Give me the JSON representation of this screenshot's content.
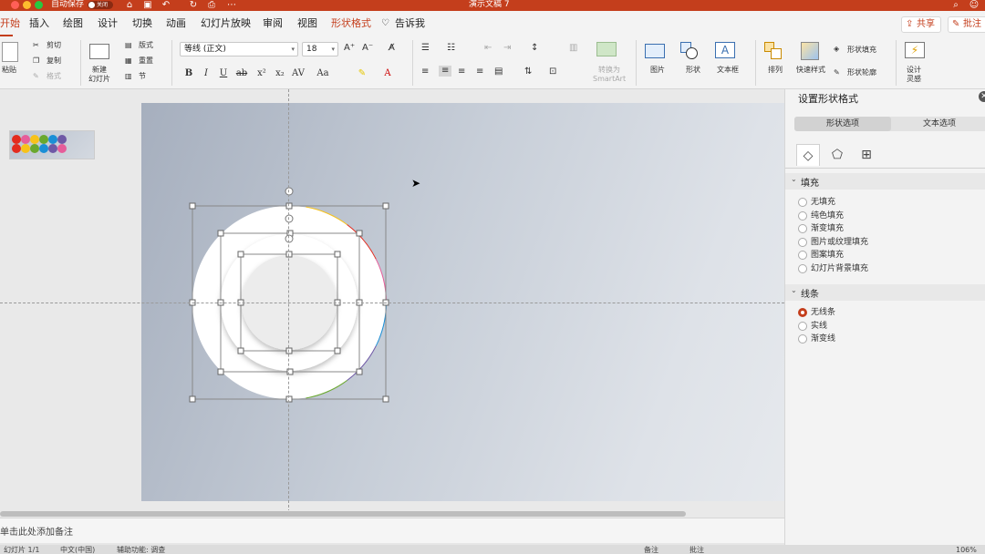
{
  "window": {
    "title": "演示文稿 7",
    "autosave_label": "自动保存",
    "autosave_state": "关闭"
  },
  "colors": {
    "accent": "#c43e1c",
    "ring": [
      "#f7c21a",
      "#e32b1f",
      "#e65d9a",
      "#1b8fd6",
      "#6f59a6",
      "#6aa82e"
    ]
  },
  "tabs": [
    {
      "label": "开始",
      "active": true
    },
    {
      "label": "插入"
    },
    {
      "label": "绘图"
    },
    {
      "label": "设计"
    },
    {
      "label": "切换"
    },
    {
      "label": "动画"
    },
    {
      "label": "幻灯片放映"
    },
    {
      "label": "审阅"
    },
    {
      "label": "视图"
    },
    {
      "label": "形状格式"
    },
    {
      "label": "告诉我"
    }
  ],
  "header_buttons": {
    "share": "共享",
    "comment": "批注"
  },
  "ribbon": {
    "paste": "粘贴",
    "cut": "剪切",
    "copy": "复制",
    "format": "格式",
    "new_slide": "新建\n幻灯片",
    "layout": "版式",
    "reset": "重置",
    "section": "节",
    "font_name": "等线 (正文)",
    "font_size": "18",
    "smartart": "转换为\nSmartArt",
    "picture": "图片",
    "shape": "形状",
    "textbox": "文本框",
    "arrange": "排列",
    "quick_styles": "快速样式",
    "shape_fill": "形状填充",
    "shape_outline": "形状轮廓",
    "designer": "设计\n灵感"
  },
  "notes_placeholder": "单击此处添加备注",
  "status": {
    "slide": "幻灯片 1/1",
    "language": "中文(中国)",
    "accessibility": "辅助功能: 调查",
    "notes": "备注",
    "comments": "批注",
    "zoom": "106%"
  },
  "pane": {
    "title": "设置形状格式",
    "tabs": [
      "形状选项",
      "文本选项"
    ],
    "fill_section": "填充",
    "fill_options": [
      "无填充",
      "纯色填充",
      "渐变填充",
      "图片或纹理填充",
      "图案填充",
      "幻灯片背景填充"
    ],
    "line_section": "线条",
    "line_options": [
      "无线条",
      "实线",
      "渐变线"
    ],
    "line_selected": 0
  },
  "thumbnail_dots": [
    "#e32b1f",
    "#e65d9a",
    "#f7c21a",
    "#6aa82e",
    "#1b8fd6",
    "#6f59a6",
    "#e32b1f",
    "#f7c21a",
    "#6aa82e",
    "#1b8fd6",
    "#6f59a6",
    "#e65d9a"
  ]
}
